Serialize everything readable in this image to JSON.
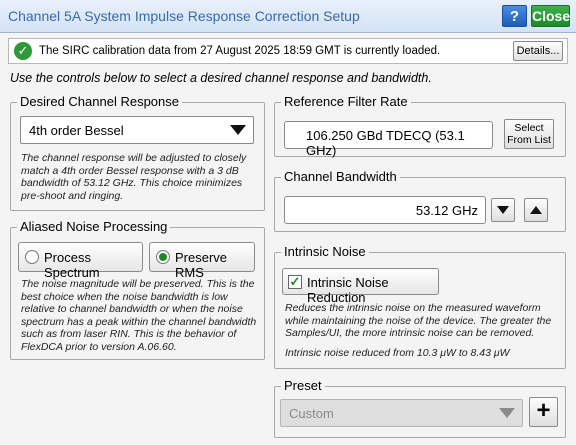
{
  "window": {
    "title": "Channel 5A System Impulse Response Correction Setup",
    "help_label": "?",
    "close_label": "Close"
  },
  "status": {
    "message": "The SIRC calibration data from 27 August 2025 18:59 GMT is currently loaded.",
    "details_label": "Details..."
  },
  "instructions": "Use the controls below to select a desired channel response and bandwidth.",
  "channel_response": {
    "legend": "Desired Channel Response",
    "selected": "4th order Bessel",
    "note": "The channel response will be adjusted to closely match a 4th order Bessel response with a 3 dB bandwidth of 53.12 GHz. This choice minimizes pre-shoot and ringing."
  },
  "aliased_noise": {
    "legend": "Aliased Noise Processing",
    "option_process": "Process Spectrum",
    "option_preserve": "Preserve RMS",
    "selected": "Preserve RMS",
    "note": "The noise magnitude will be preserved. This is the best choice when the noise bandwidth is low relative to channel bandwidth or when the noise spectrum has a peak within the channel bandwidth such as from laser RIN. This is the behavior of FlexDCA prior to version A.06.60."
  },
  "reference_filter": {
    "legend": "Reference Filter Rate",
    "value": "106.250 GBd TDECQ (53.1 GHz)",
    "select_label": "Select From List"
  },
  "channel_bandwidth": {
    "legend": "Channel Bandwidth",
    "value": "53.12 GHz"
  },
  "intrinsic_noise": {
    "legend": "Intrinsic Noise",
    "checkbox_label": "Intrinsic Noise Reduction",
    "checked": true,
    "note": "Reduces the intrinsic noise on the measured waveform while maintaining the noise of the device. The greater the Samples/UI, the more intrinsic noise can be removed.",
    "result": "Intrinsic noise reduced from 10.3 μW to 8.43 μW"
  },
  "preset": {
    "legend": "Preset",
    "selected": "Custom",
    "add_label": "+"
  },
  "colors": {
    "accent_green": "#1f8a2a",
    "help_blue": "#1f5cb5",
    "title_blue": "#3a6aa8"
  }
}
